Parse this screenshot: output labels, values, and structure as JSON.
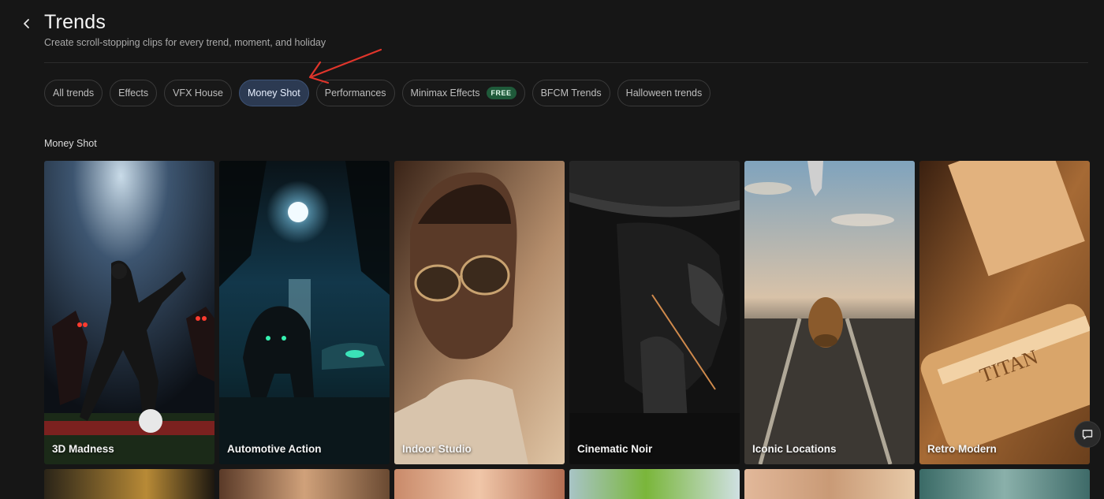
{
  "header": {
    "title": "Trends",
    "subtitle": "Create scroll-stopping clips for every trend, moment, and holiday"
  },
  "tabs": [
    {
      "label": "All trends"
    },
    {
      "label": "Effects"
    },
    {
      "label": "VFX House"
    },
    {
      "label": "Money Shot",
      "active": true
    },
    {
      "label": "Performances"
    },
    {
      "label": "Minimax Effects",
      "badge": "FREE"
    },
    {
      "label": "BFCM Trends"
    },
    {
      "label": "Halloween trends"
    }
  ],
  "section": {
    "title": "Money Shot"
  },
  "cards": [
    {
      "label": "3D Madness"
    },
    {
      "label": "Automotive Action"
    },
    {
      "label": "Indoor Studio"
    },
    {
      "label": "Cinematic Noir"
    },
    {
      "label": "Iconic Locations"
    },
    {
      "label": "Retro Modern"
    }
  ],
  "colors": {
    "active_tab": "#2c3a52",
    "free_badge": "#1f5a3a",
    "annotation_arrow": "#e0352b"
  }
}
